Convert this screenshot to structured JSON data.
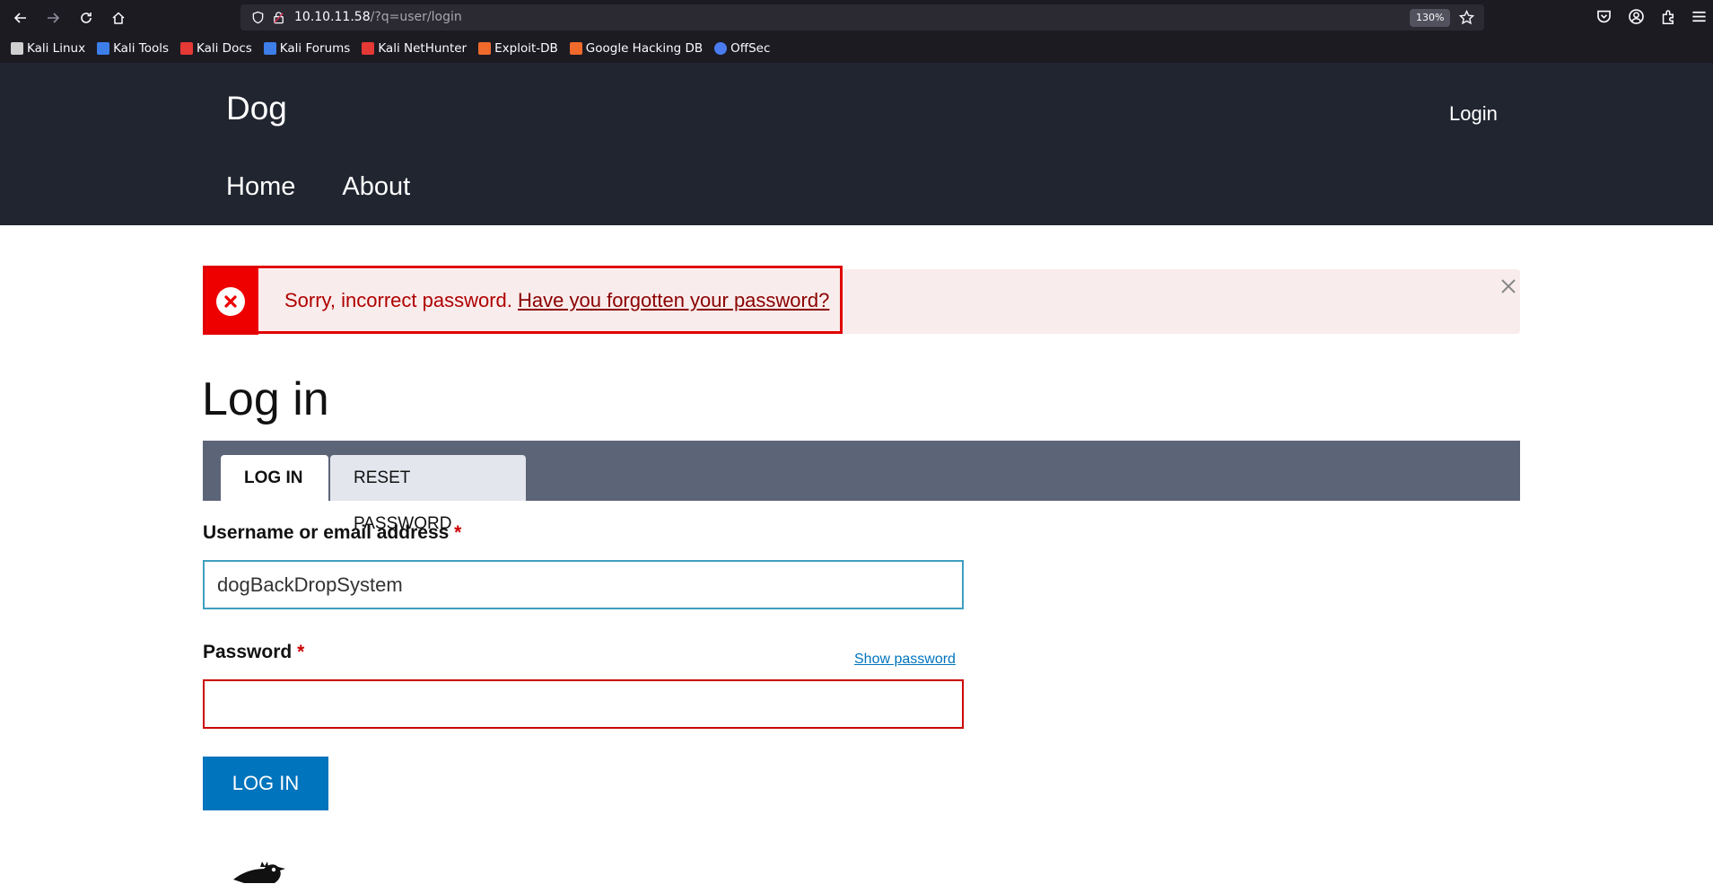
{
  "browser": {
    "url_host": "10.10.11.58",
    "url_path": "/?q=user/login",
    "zoom": "130%",
    "bookmarks": [
      {
        "label": "Kali Linux",
        "color": "#cfcfcf"
      },
      {
        "label": "Kali Tools",
        "color": "#3d7ee8"
      },
      {
        "label": "Kali Docs",
        "color": "#e53935"
      },
      {
        "label": "Kali Forums",
        "color": "#3d7ee8"
      },
      {
        "label": "Kali NetHunter",
        "color": "#e53935"
      },
      {
        "label": "Exploit-DB",
        "color": "#f06a2b"
      },
      {
        "label": "Google Hacking DB",
        "color": "#f06a2b"
      },
      {
        "label": "OffSec",
        "color": "#4a7cf0"
      }
    ]
  },
  "site": {
    "name": "Dog",
    "header_login": "Login",
    "nav": [
      "Home",
      "About"
    ]
  },
  "message": {
    "text": "Sorry, incorrect password.",
    "link": "Have you forgotten your password?"
  },
  "page": {
    "title": "Log in"
  },
  "tabs": {
    "login": "LOG IN",
    "reset": "RESET PASSWORD"
  },
  "form": {
    "username_label": "Username or email address",
    "username_value": "dogBackDropSystem",
    "password_label": "Password",
    "required_mark": "*",
    "show_password": "Show password",
    "submit": "LOG IN"
  },
  "colors": {
    "header_bg": "#202530",
    "error": "#ee0000",
    "primary": "#0074bd"
  }
}
